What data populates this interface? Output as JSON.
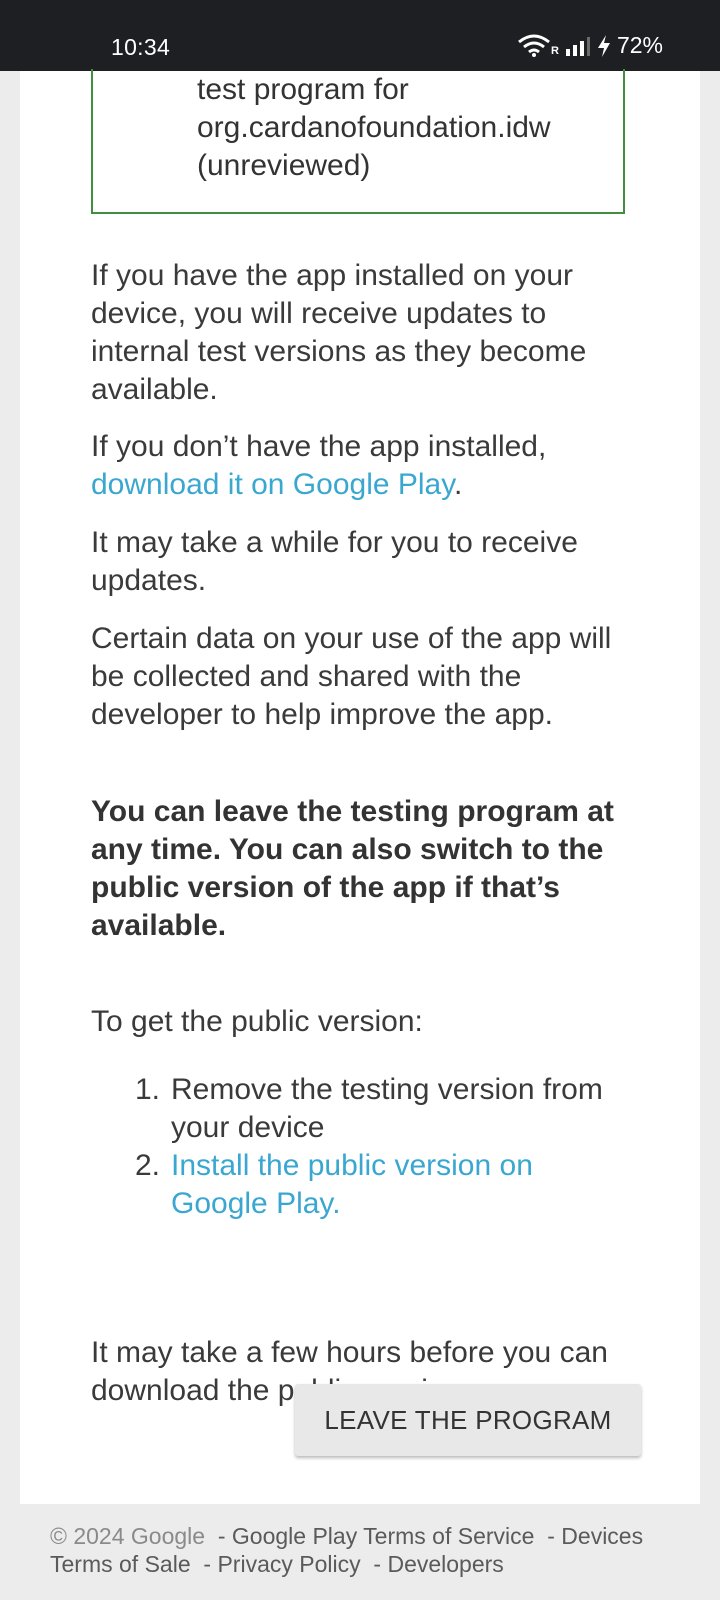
{
  "status_bar": {
    "time": "10:34",
    "battery": "72%",
    "network_label": "R",
    "icons": [
      "wifi-icon",
      "cell-signal-icon",
      "charging-bolt-icon"
    ]
  },
  "test_program": {
    "text": "test program for org.cardanofoundation.idw (unreviewed)",
    "border_color": "#3f8f3f"
  },
  "content": {
    "paragraph_updates": "If you have the app installed on your device, you will receive updates to internal test versions as they become available.",
    "paragraph_install_prefix": "If you don’t have the app installed, ",
    "paragraph_install_link": "download it on Google Play",
    "paragraph_install_suffix": ".",
    "paragraph_wait": "It may take a while for you to receive updates.",
    "paragraph_data": "Certain data on your use of the app will be collected and shared with the developer to help improve the app.",
    "paragraph_leave_bold": "You can leave the testing program at any time. You can also switch to the public version of the app if that’s available.",
    "public_version_heading": "To get the public version:",
    "steps": [
      {
        "number": "1.",
        "text": "Remove the testing version from your device",
        "is_link": false
      },
      {
        "number": "2.",
        "text": "Install the public version on Google Play.",
        "is_link": true
      }
    ],
    "paragraph_hours": "It may take a few hours before you can download the public version."
  },
  "leave_button": {
    "label": "LEAVE THE PROGRAM"
  },
  "footer": {
    "copyright": "© 2024 Google",
    "separator": "-",
    "links": [
      "Google Play Terms of Service",
      "Devices Terms of Sale",
      "Privacy Policy",
      "Developers"
    ]
  },
  "colors": {
    "link": "#3aa7d1",
    "status_bar_bg": "#1d1f23",
    "page_bg": "#ececec"
  }
}
